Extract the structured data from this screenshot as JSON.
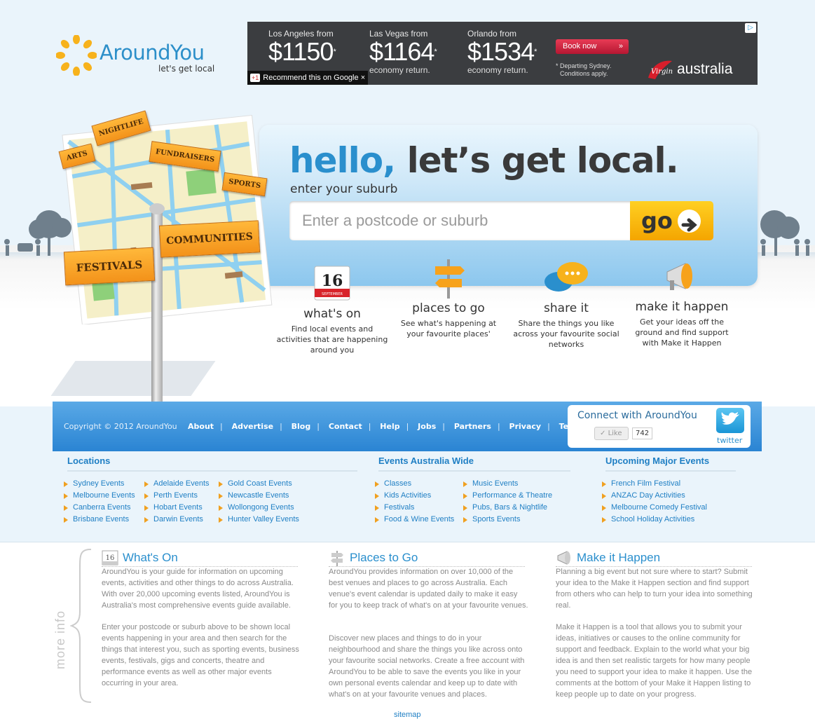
{
  "brand": {
    "name_part1": "Around",
    "name_part2": "You",
    "tagline": "let's get local"
  },
  "ad": {
    "deals": [
      {
        "from": "Los Angeles from",
        "price": "$1150",
        "mark": "*",
        "note": ""
      },
      {
        "from": "Las Vegas from",
        "price": "$1164",
        "mark": "*",
        "note": "economy return."
      },
      {
        "from": "Orlando from",
        "price": "$1534",
        "mark": "*",
        "note": "economy return."
      }
    ],
    "book_label": "Book now",
    "book_arrow": "»",
    "departing_line1": "* Departing Sydney.",
    "departing_line2": "Conditions apply.",
    "airline": "australia",
    "recommend_badge": "+1",
    "recommend_text": "Recommend this on Google",
    "recommend_close": "×"
  },
  "hero": {
    "hello": "hello,",
    "headline_rest": "let’s get local.",
    "sub": "enter your suburb",
    "search_placeholder": "Enter a postcode or suburb",
    "go_label": "go",
    "go_arrow": "➜",
    "signs": [
      "NIGHTLIFE",
      "ARTS",
      "FUNDRAISERS",
      "SPORTS",
      "COMMUNITIES",
      "FESTIVALS"
    ],
    "calendar_day": "16",
    "calendar_month": "SEPTEMBER"
  },
  "features": [
    {
      "title": "what's on",
      "desc": "Find local events and activities that are happening around you"
    },
    {
      "title": "places to go",
      "desc": "See what's happening at your favourite places'"
    },
    {
      "title": "share it",
      "desc": "Share the things you like across your favourite social networks"
    },
    {
      "title": "make it happen",
      "desc": "Get your ideas off the ground and find support with Make it Happen"
    }
  ],
  "footer": {
    "copyright": "Copyright © 2012 AroundYou",
    "nav": [
      "About",
      "Advertise",
      "Blog",
      "Contact",
      "Help",
      "Jobs",
      "Partners",
      "Privacy",
      "Terms"
    ],
    "connect_title": "Connect with AroundYou",
    "like_label": "Like",
    "like_count": "742",
    "twitter_label": "twitter"
  },
  "columns": {
    "locations": {
      "heading": "Locations",
      "col1": [
        "Sydney Events",
        "Melbourne Events",
        "Canberra Events",
        "Brisbane Events"
      ],
      "col2": [
        "Adelaide Events",
        "Perth Events",
        "Hobart Events",
        "Darwin Events"
      ],
      "col3": [
        "Gold Coast Events",
        "Newcastle Events",
        "Wollongong Events",
        "Hunter Valley Events"
      ]
    },
    "events": {
      "heading": "Events Australia Wide",
      "col1": [
        "Classes",
        "Kids Activities",
        "Festivals",
        "Food & Wine Events"
      ],
      "col2": [
        "Music Events",
        "Performance & Theatre",
        "Pubs, Bars & Nightlife",
        "Sports Events"
      ]
    },
    "major": {
      "heading": "Upcoming Major Events",
      "col1": [
        "French Film Festival",
        "ANZAC Day Activities",
        "Melbourne Comedy Festival",
        "School Holiday Activities"
      ]
    }
  },
  "more_info": {
    "label": "more info",
    "whats_on": {
      "heading": "What's On",
      "p1": "AroundYou is your guide for information on upcoming events, activities and other things to do across Australia. With over 20,000 upcoming events listed, AroundYou is Australia's most comprehensive events guide available.",
      "p2": "Enter your postcode or suburb above to be shown local events happening in your area and then search for the things that interest you, such as sporting events, business events, festivals, gigs and concerts, theatre and performance events as well as other major events occurring in your area."
    },
    "places": {
      "heading": "Places to Go",
      "p1": "AroundYou provides information on over 10,000 of the best venues and places to go across Australia. Each venue's event calendar is updated daily to make it easy for you to keep track of what's on at your favourite venues.",
      "p2": "Discover new places and things to do in your neighbourhood and share the things you like across onto your favourite social networks. Create a free account with AroundYou to be able to save the events you like in your own personal events calendar and keep up to date with what's on at your favourite venues and places."
    },
    "make_it": {
      "heading": "Make it Happen",
      "p1": "Planning a big event but not sure where to start? Submit your idea to the Make it Happen section and find support from others who can help to turn your idea into something real.",
      "p2": "Make it Happen is a tool that allows you to submit your ideas, initiatives or causes to the online community for support and feedback. Explain to the world what your big idea is and then set realistic targets for how many people you need to support your idea to make it happen. Use the comments at the bottom of your Make it Happen listing to keep people up to date on your progress."
    },
    "sitemap": "sitemap"
  },
  "colors": {
    "brand_blue": "#2a8fcd",
    "accent_orange": "#f4a500",
    "footer_blue": "#2a84d3",
    "link_blue": "#1f7fc4"
  }
}
